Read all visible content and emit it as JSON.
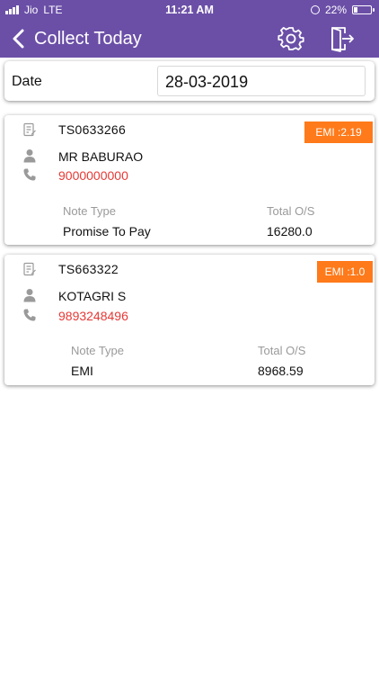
{
  "status_bar": {
    "carrier": "Jio",
    "network": "LTE",
    "time": "11:21 AM",
    "battery": "22%",
    "battery_level": 0.22
  },
  "app_bar": {
    "title": "Collect Today"
  },
  "date_filter": {
    "label": "Date",
    "value": "28-03-2019"
  },
  "customers": [
    {
      "account": "TS0633266",
      "name": "MR  BABURAO",
      "phone": "9000000000",
      "emi": "EMI :2.19",
      "note_type_label": "Note Type",
      "note_type": "Promise To Pay",
      "total_label": "Total O/S",
      "total": "16280.0"
    },
    {
      "account": "TS663322",
      "name": "KOTAGRI S",
      "phone": "9893248496",
      "emi": "EMI :1.0",
      "note_type_label": "Note Type",
      "note_type": "EMI",
      "total_label": "Total O/S",
      "total": "8968.59"
    }
  ],
  "colors": {
    "primary": "#6b4fa7",
    "badge": "#ff7a1a",
    "phone": "#e53935",
    "muted": "#9a9a9a"
  }
}
